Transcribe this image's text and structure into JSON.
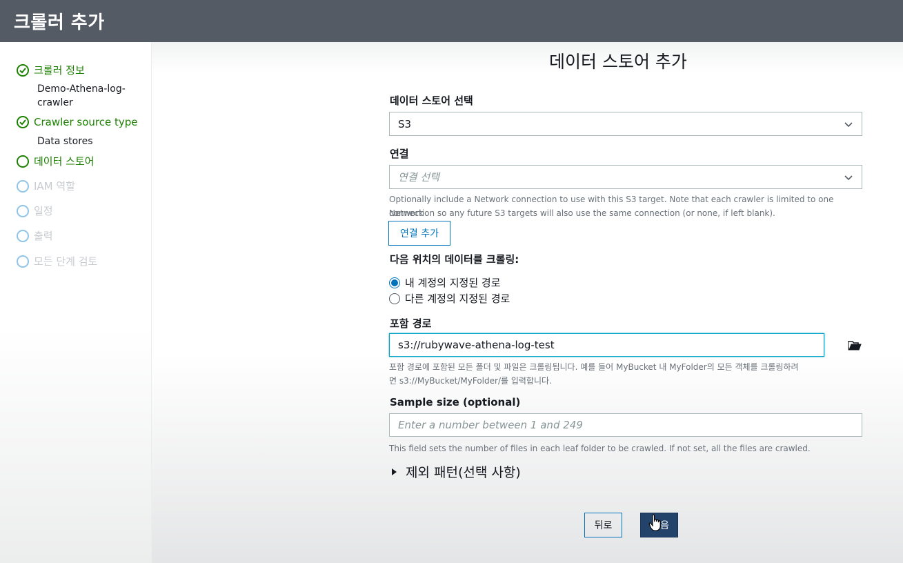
{
  "header": {
    "title": "크롤러 추가"
  },
  "sidebar": {
    "steps": [
      {
        "label": "크롤러 정보",
        "state": "done",
        "sub": [
          "Demo-Athena-log-",
          "crawler"
        ]
      },
      {
        "label": "Crawler source type",
        "state": "done",
        "sub": [
          "Data stores"
        ]
      },
      {
        "label": "데이터 스토어",
        "state": "current"
      },
      {
        "label": "IAM 역할",
        "state": "pending"
      },
      {
        "label": "일정",
        "state": "pending"
      },
      {
        "label": "출력",
        "state": "pending"
      },
      {
        "label": "모든 단계 검토",
        "state": "pending"
      }
    ]
  },
  "main": {
    "title": "데이터 스토어 추가",
    "datastore": {
      "label": "데이터 스토어 선택",
      "value": "S3"
    },
    "connection": {
      "label": "연결",
      "placeholder": "연결 선택",
      "help_line1": "Optionally include a Network connection to use with this S3 target. Note that each crawler is limited to one Network",
      "help_line2": "connection so any future S3 targets will also use the same connection (or none, if left blank).",
      "add_button": "연결 추가"
    },
    "crawl_location": {
      "label": "다음 위치의 데이터를 크롤링:",
      "options": [
        "내 계정의 지정된 경로",
        "다른 계정의 지정된 경로"
      ],
      "selected": 0
    },
    "include_path": {
      "label": "포함 경로",
      "value": "s3://rubywave-athena-log-test",
      "help_line1": "포함 경로에 포함된 모든 폴더 및 파일은 크롤링됩니다. 예를 들어 MyBucket 내 MyFolder의 모든 객체를 크롤링하려",
      "help_line2": "면 s3://MyBucket/MyFolder/를 입력합니다."
    },
    "sample_size": {
      "label": "Sample size (optional)",
      "placeholder": "Enter a number between 1 and 249",
      "help": "This field sets the number of files in each leaf folder to be crawled. If not set, all the files are crawled."
    },
    "exclude_patterns": {
      "label": "제외 패턴(선택 사항)"
    },
    "buttons": {
      "back": "뒤로",
      "next": "음"
    }
  },
  "colors": {
    "header_bg": "#545b64",
    "done_green": "#1d8102",
    "primary_blue": "#0073bb",
    "next_btn": "#23436b"
  },
  "icons": [
    "check-icon",
    "chevron-down-icon",
    "folder-open-icon",
    "caret-right-icon",
    "hand-cursor-icon"
  ]
}
